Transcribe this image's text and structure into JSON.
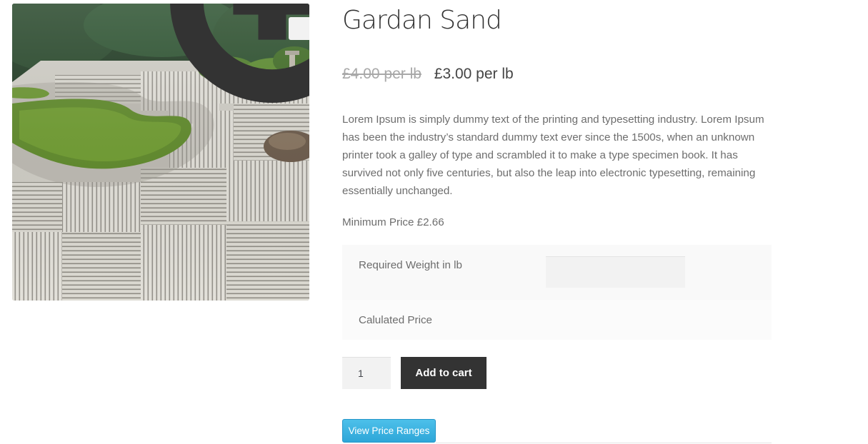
{
  "product": {
    "title": "Gardan Sand",
    "regular_price": "£4.00 per lb",
    "sale_price": "£3.00 per lb",
    "description": "Lorem Ipsum is simply dummy text of the printing and typesetting industry. Lorem Ipsum has been the industry’s standard dummy text ever since the 1500s, when an unknown printer took a galley of type and scrambled it to make a type specimen book. It has survived not only five centuries, but also the leap into electronic typesetting, remaining essentially unchanged.",
    "minimum_price": "Minimum Price £2.66"
  },
  "gallery": {
    "zoom_icon": "magnifier-plus-icon"
  },
  "calculator": {
    "weight_label": "Required Weight in lb",
    "weight_value": "",
    "price_label": "Calulated Price"
  },
  "cart": {
    "quantity": "1",
    "add_label": "Add to cart"
  },
  "ranges": {
    "button_label": "View Price Ranges"
  },
  "colors": {
    "button_dark": "#333333",
    "button_blue": "#36ade0",
    "text": "#6d6d6d"
  }
}
